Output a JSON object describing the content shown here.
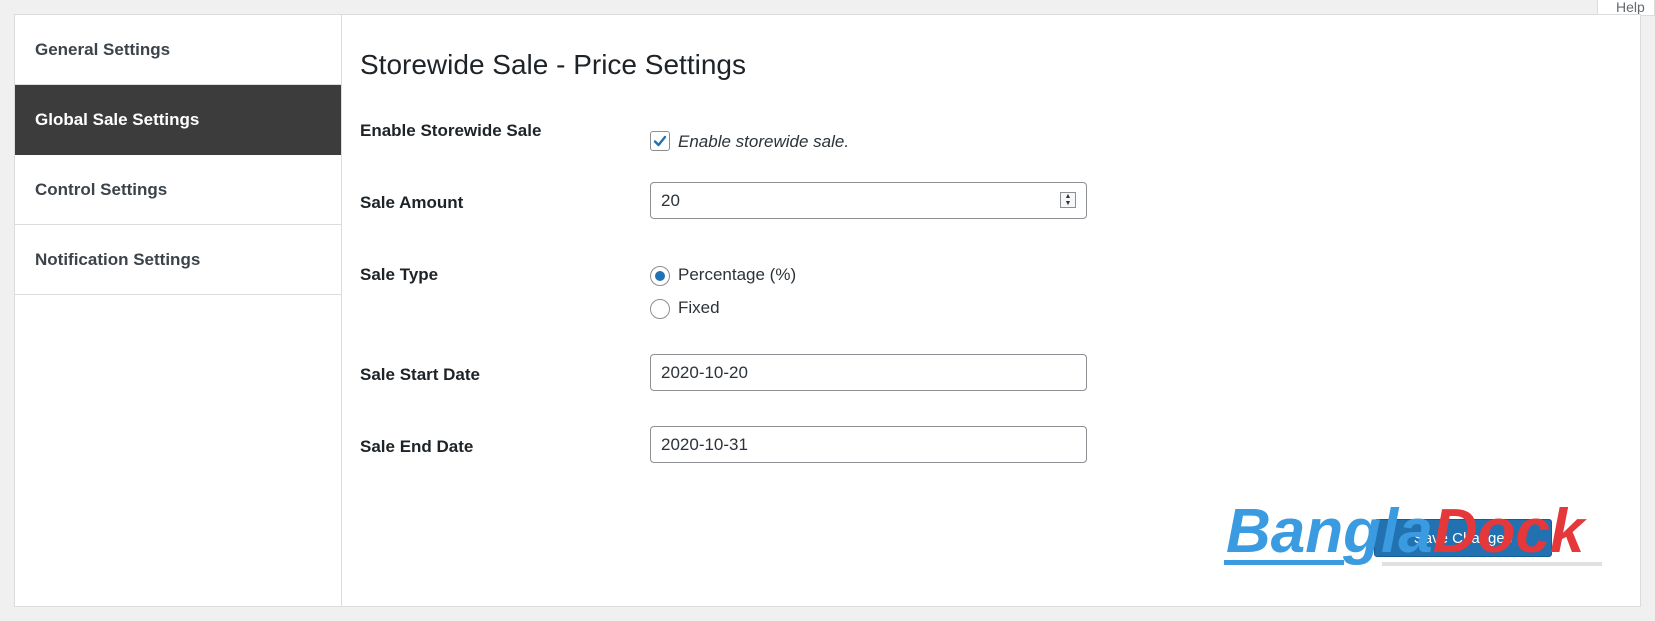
{
  "help_tab": {
    "label": "Help"
  },
  "sidebar": {
    "items": [
      {
        "label": "General Settings",
        "active": false
      },
      {
        "label": "Global Sale Settings",
        "active": true
      },
      {
        "label": "Control Settings",
        "active": false
      },
      {
        "label": "Notification Settings",
        "active": false
      }
    ]
  },
  "main": {
    "title": "Storewide Sale - Price Settings",
    "enable_sale": {
      "label": "Enable Storewide Sale",
      "checkbox_label": "Enable storewide sale.",
      "checked": true
    },
    "sale_amount": {
      "label": "Sale Amount",
      "value": "20"
    },
    "sale_type": {
      "label": "Sale Type",
      "options": [
        {
          "label": "Percentage (%)",
          "selected": true
        },
        {
          "label": "Fixed",
          "selected": false
        }
      ]
    },
    "sale_start": {
      "label": "Sale Start Date",
      "value": "2020-10-20"
    },
    "sale_end": {
      "label": "Sale End Date",
      "value": "2020-10-31"
    },
    "save_label": "Save Changes"
  },
  "watermark": {
    "part1": "Bangla",
    "part2": "Dock",
    "color1": "#3b9be0",
    "color2": "#e5383b"
  },
  "colors": {
    "accent": "#2271b1",
    "active_nav_bg": "#3c3c3c"
  }
}
